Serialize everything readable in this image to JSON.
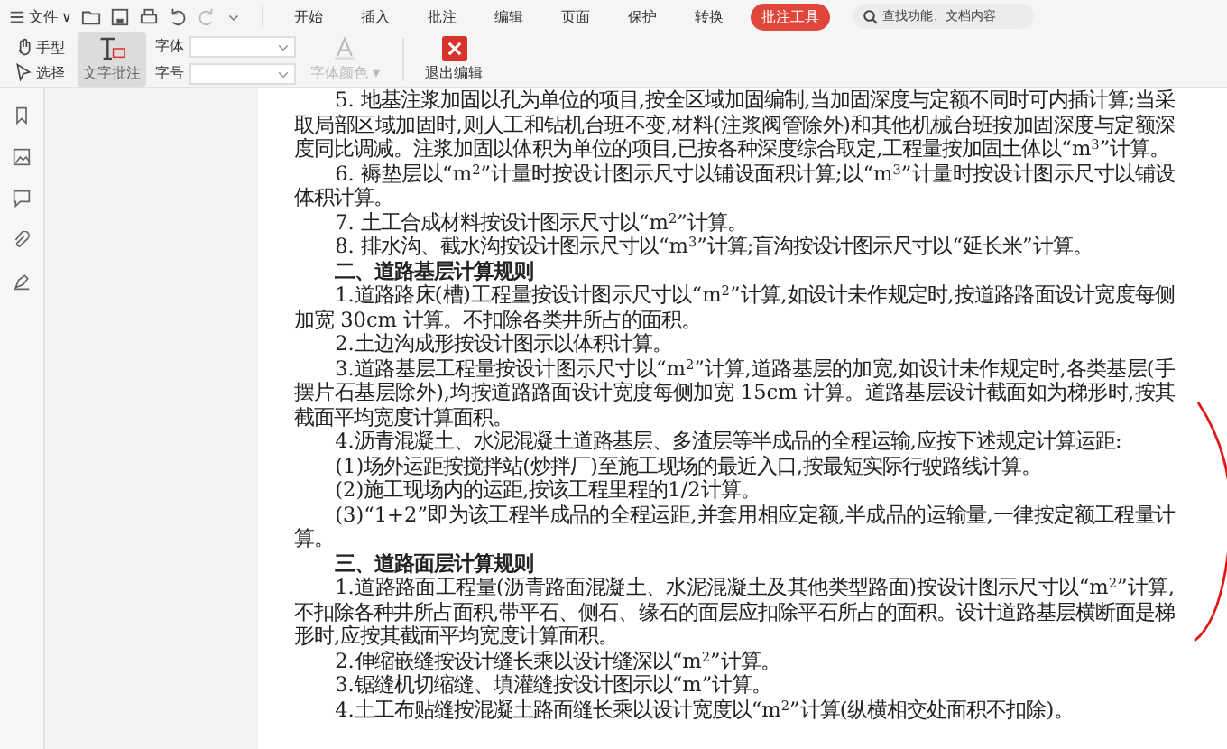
{
  "menu": {
    "file": "文件",
    "caret": "∨"
  },
  "tabs": [
    {
      "label": "开始",
      "selected": false
    },
    {
      "label": "插入",
      "selected": false
    },
    {
      "label": "批注",
      "selected": false
    },
    {
      "label": "编辑",
      "selected": false
    },
    {
      "label": "页面",
      "selected": false
    },
    {
      "label": "保护",
      "selected": false
    },
    {
      "label": "转换",
      "selected": false
    },
    {
      "label": "批注工具",
      "selected": true
    }
  ],
  "search": {
    "placeholder": "查找功能、文档内容"
  },
  "tools": {
    "hand": "手型",
    "select": "选择",
    "text_comment": {
      "label": "文字批注",
      "selected": true
    },
    "font_label": "字体",
    "size_label": "字号",
    "font_color": {
      "label": "字体颜色",
      "caret": "▾",
      "disabled": true
    },
    "exit": "退出编辑"
  },
  "document": {
    "paragraphs": [
      {
        "kind": "text",
        "text": "5. 地基注浆加固以孔为单位的项目,按全区域加固编制,当加固深度与定额不同时可内插计算;当采取局部区域加固时,则人工和钻机台班不变,材料(注浆阀管除外)和其他机械台班按加固深度与定额深度同比调减。注浆加固以体积为单位的项目,已按各种深度综合取定,工程量按加固土体以“m$^{3}$”计算。"
      },
      {
        "kind": "text",
        "text": "6. 褥垫层以“m$^{2}$”计量时按设计图示尺寸以铺设面积计算;以“m$^{3}$”计量时按设计图示尺寸以铺设体积计算。"
      },
      {
        "kind": "text",
        "text": "7. 土工合成材料按设计图示尺寸以“m$^{2}$”计算。"
      },
      {
        "kind": "text",
        "text": "8. 排水沟、截水沟按设计图示尺寸以“m$^{3}$”计算;盲沟按设计图示尺寸以“延长米”计算。"
      },
      {
        "kind": "heading",
        "text": "二、道路基层计算规则"
      },
      {
        "kind": "text",
        "text": "1.道路路床(槽)工程量按设计图示尺寸以“m$^{2}$”计算,如设计未作规定时,按道路路面设计宽度每侧加宽 30cm 计算。不扣除各类井所占的面积。"
      },
      {
        "kind": "text",
        "text": "2.土边沟成形按设计图示以体积计算。"
      },
      {
        "kind": "text",
        "text": "3.道路基层工程量按设计图示尺寸以“m$^{2}$”计算,道路基层的加宽,如设计未作规定时,各类基层(手摆片石基层除外),均按道路路面设计宽度每侧加宽 15cm 计算。道路基层设计截面如为梯形时,按其截面平均宽度计算面积。"
      },
      {
        "kind": "text",
        "text": "4.沥青混凝土、水泥混凝土道路基层、多渣层等半成品的全程运输,应按下述规定计算运距:"
      },
      {
        "kind": "text",
        "text": "(1)场外运距按搅拌站(炒拌厂)至施工现场的最近入口,按最短实际行驶路线计算。"
      },
      {
        "kind": "text",
        "text": "(2)施工现场内的运距,按该工程里程的1/2计算。"
      },
      {
        "kind": "text",
        "text": "(3)“1+2”即为该工程半成品的全程运距,并套用相应定额,半成品的运输量,一律按定额工程量计算。"
      },
      {
        "kind": "heading",
        "text": "三、道路面层计算规则"
      },
      {
        "kind": "text",
        "text": "1.道路路面工程量(沥青路面混凝土、水泥混凝土及其他类型路面)按设计图示尺寸以“m$^{2}$”计算,不扣除各种井所占面积,带平石、侧石、缘石的面层应扣除平石所占的面积。设计道路基层横断面是梯形时,应按其截面平均宽度计算面积。"
      },
      {
        "kind": "text",
        "text": "2.伸缩嵌缝按设计缝长乘以设计缝深以“m$^{2}$”计算。"
      },
      {
        "kind": "text",
        "text": "3.锯缝机切缩缝、填灌缝按设计图示以“m”计算。"
      },
      {
        "kind": "text",
        "text": "4.土工布贴缝按混凝土路面缝长乘以设计宽度以“m$^{2}$”计算(纵横相交处面积不扣除)。"
      }
    ]
  }
}
